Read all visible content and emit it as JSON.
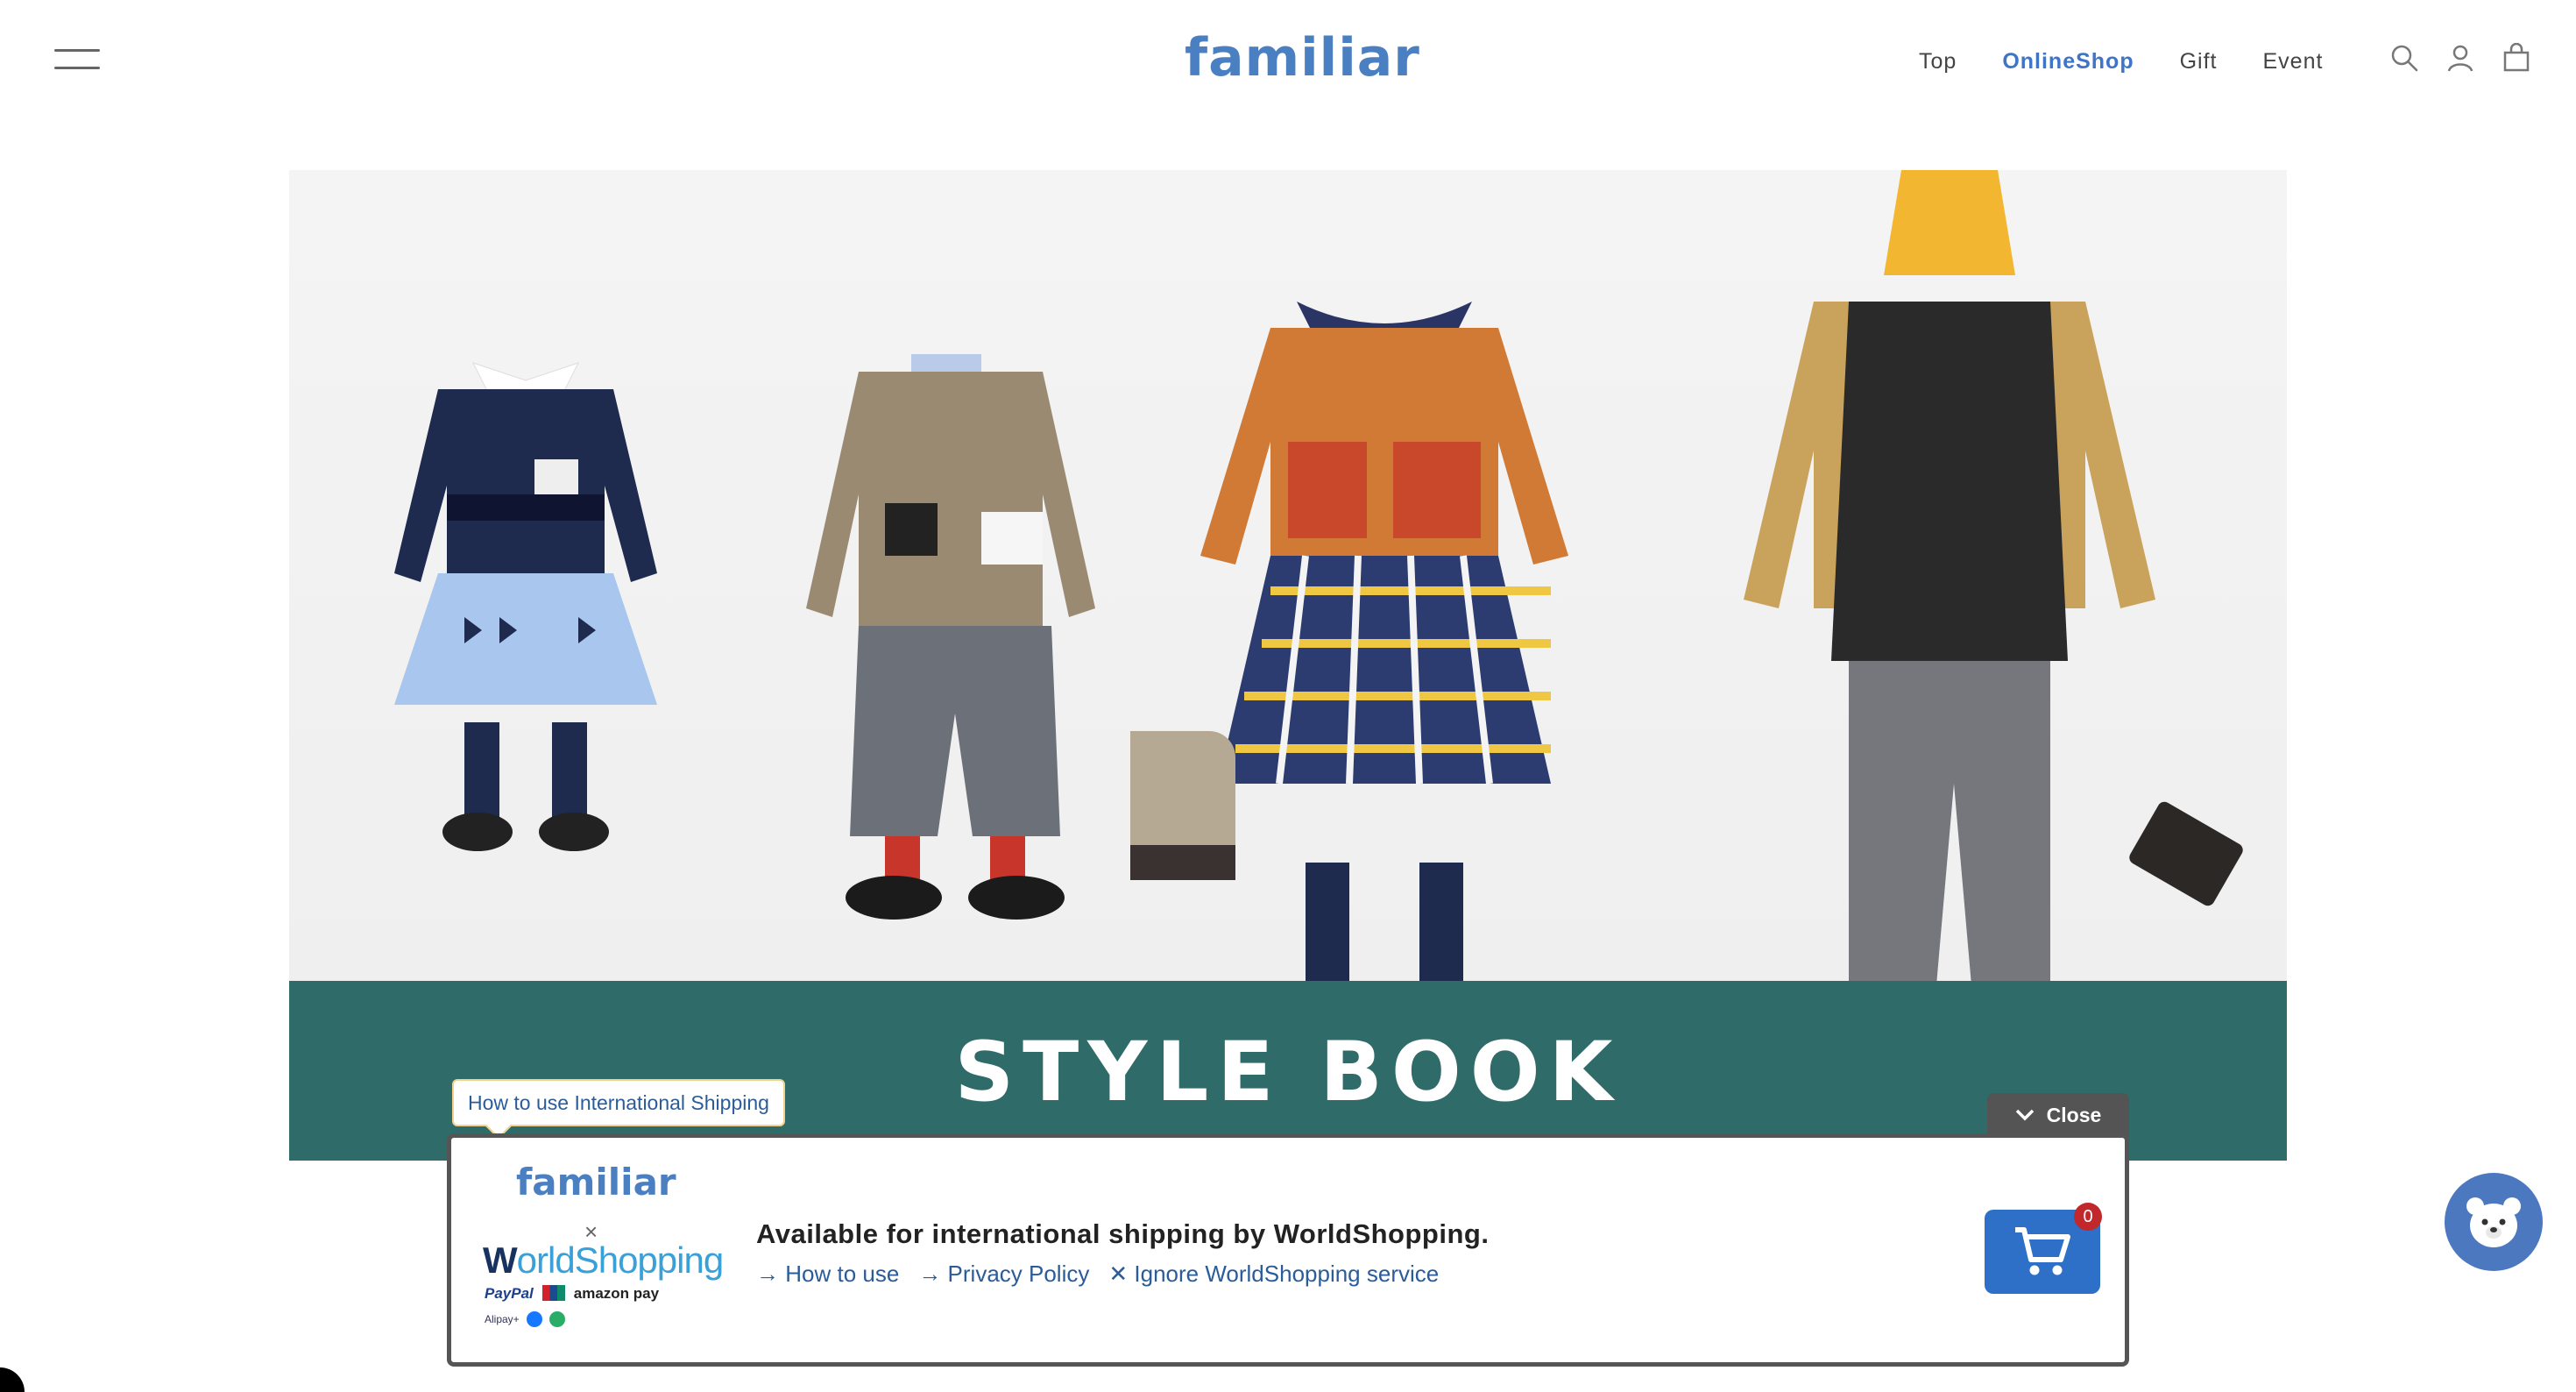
{
  "header": {
    "logo": "familiar",
    "nav": [
      {
        "label": "Top",
        "active": false
      },
      {
        "label": "OnlineShop",
        "active": true
      },
      {
        "label": "Gift",
        "active": false
      },
      {
        "label": "Event",
        "active": false
      }
    ],
    "icons": [
      "menu-icon",
      "search-icon",
      "account-icon",
      "bag-icon"
    ]
  },
  "hero": {
    "title": "STYLE BOOK",
    "band_color": "#2f6b68"
  },
  "worldshopping": {
    "tooltip": "How to use International Shipping",
    "close_label": "Close",
    "logo_brand": "familiar",
    "logo_times": "×",
    "logo_ws_first": "W",
    "logo_ws_rest": "orldShopping",
    "pay_row1": [
      "PayPal",
      "amazon pay"
    ],
    "pay_row2": [
      "Alipay+"
    ],
    "headline": "Available for international shipping by WorldShopping.",
    "links": [
      {
        "label": "How to use",
        "icon": "arrow-right-icon"
      },
      {
        "label": "Privacy Policy",
        "icon": "arrow-right-icon"
      },
      {
        "label": "Ignore WorldShopping service",
        "icon": "close-icon"
      }
    ],
    "cart_count": "0",
    "accent": "#2e6fc7"
  },
  "colors": {
    "brand": "#4a7fc1",
    "nav_active": "#3f74c6"
  }
}
